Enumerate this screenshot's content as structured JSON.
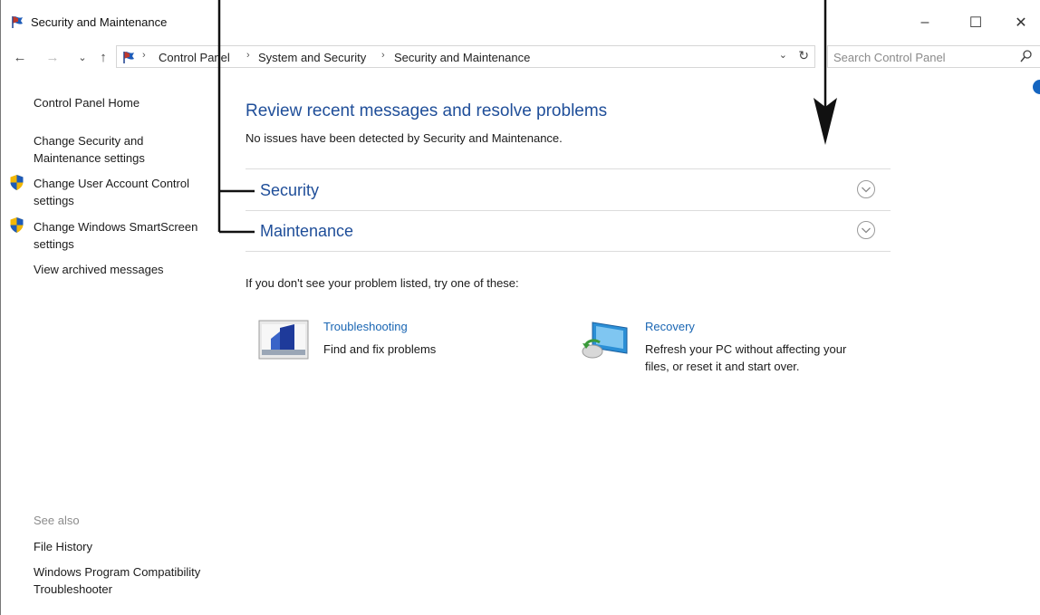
{
  "window": {
    "title": "Security and Maintenance",
    "icon": "flag-icon",
    "controls": {
      "minimize": "–",
      "maximize": "☐",
      "close": "✕"
    }
  },
  "nav": {
    "back_icon": "←",
    "forward_icon": "→",
    "recent_icon": "⌄",
    "up_icon": "↑",
    "breadcrumbs": [
      "Control Panel",
      "System and Security",
      "Security and Maintenance"
    ],
    "separator": "›",
    "dropdown_icon": "⌄",
    "refresh_icon": "↻",
    "search": {
      "placeholder": "Search Control Panel",
      "icon": "search-icon"
    }
  },
  "sidebar": {
    "home": "Control Panel Home",
    "items": [
      {
        "label": "Change Security and Maintenance settings",
        "icon": null
      },
      {
        "label": "Change User Account Control settings",
        "icon": "shield-icon"
      },
      {
        "label": "Change Windows SmartScreen settings",
        "icon": "shield-icon"
      },
      {
        "label": "View archived messages",
        "icon": null
      }
    ],
    "see_also": {
      "heading": "See also",
      "links": [
        "File History",
        "Windows Program Compatibility Troubleshooter"
      ]
    }
  },
  "main": {
    "heading": "Review recent messages and resolve problems",
    "status": "No issues have been detected by Security and Maintenance.",
    "sections": [
      {
        "title": "Security",
        "icon": "chevron-down-icon"
      },
      {
        "title": "Maintenance",
        "icon": "chevron-down-icon"
      }
    ],
    "hint": "If you don't see your problem listed, try one of these:",
    "tools": [
      {
        "title": "Troubleshooting",
        "desc": "Find and fix problems",
        "icon": "troubleshooting-icon"
      },
      {
        "title": "Recovery",
        "desc": "Refresh your PC without affecting your files, or reset it and start over.",
        "icon": "recovery-icon"
      }
    ]
  },
  "colors": {
    "heading_blue": "#1f4e99",
    "link_blue": "#1a66b3",
    "shield_yellow": "#f2b705",
    "shield_blue": "#1e5bb8"
  }
}
